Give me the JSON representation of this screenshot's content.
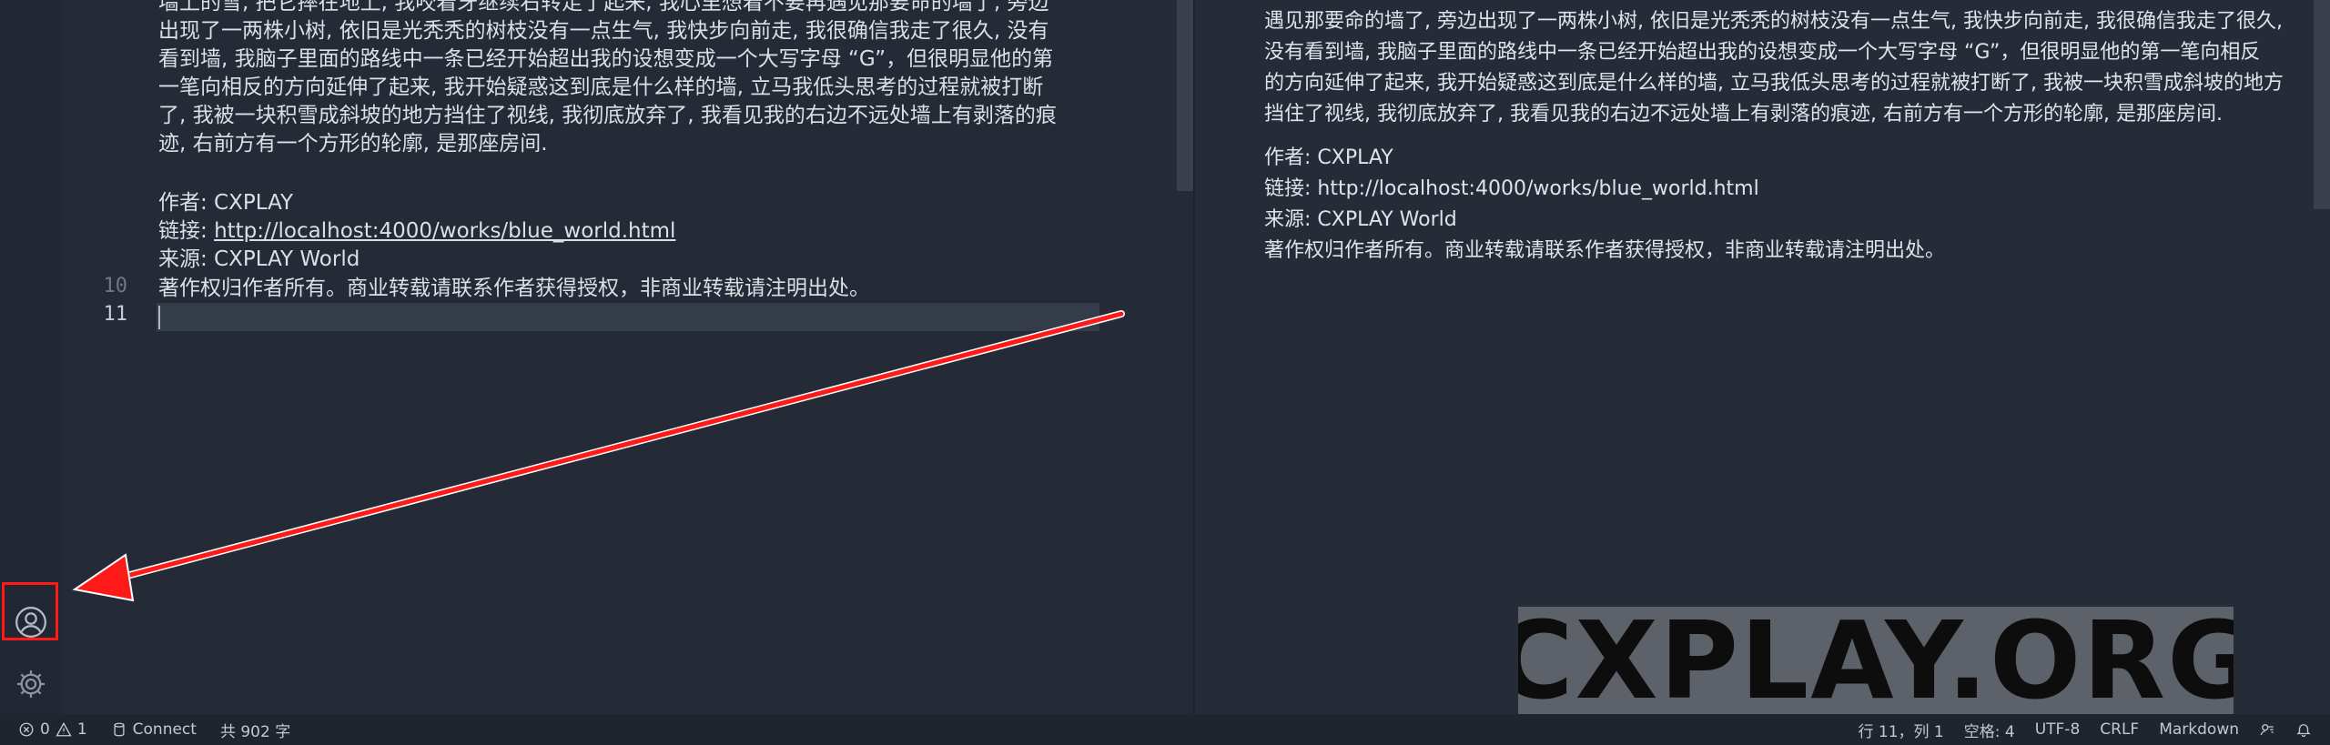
{
  "editor": {
    "lines": [
      "墙上的雪, 把它摔在地上, 我咬着牙继续右转走了起来, 我心里想着不要再遇见那要命的墙了, 旁边",
      "出现了一两株小树, 依旧是光秃秃的树枝没有一点生气, 我快步向前走, 我很确信我走了很久, 没有",
      "看到墙, 我脑子里面的路线中一条已经开始超出我的设想变成一个大写字母 “G”，但很明显他的第",
      "一笔向相反的方向延伸了起来, 我开始疑惑这到底是什么样的墙, 立马我低头思考的过程就被打断",
      "了, 我被一块积雪成斜坡的地方挡住了视线, 我彻底放弃了, 我看见我的右边不远处墙上有剥落的痕",
      "迹, 右前方有一个方形的轮廓, 是那座房间.",
      "",
      "作者: CXPLAY",
      "链接: ",
      "来源: CXPLAY World",
      "著作权归作者所有。商业转载请联系作者获得授权，非商业转载请注明出处。",
      ""
    ],
    "link_text": "http://localhost:4000/works/blue_world.html",
    "line_numbers": [
      "10",
      "11"
    ]
  },
  "preview": {
    "paragraph_lines": [
      "遇见那要命的墙了, 旁边出现了一两株小树, 依旧是光秃秃的树枝没有一点生气, 我快步向前走, 我很确信我走了很久,",
      "没有看到墙, 我脑子里面的路线中一条已经开始超出我的设想变成一个大写字母 “G”，但很明显他的第一笔向相反",
      "的方向延伸了起来, 我开始疑惑这到底是什么样的墙, 立马我低头思考的过程就被打断了, 我被一块积雪成斜坡的地方",
      "挡住了视线, 我彻底放弃了, 我看见我的右边不远处墙上有剥落的痕迹, 右前方有一个方形的轮廓, 是那座房间."
    ],
    "meta_lines": [
      "作者: CXPLAY",
      "链接: http://localhost:4000/works/blue_world.html",
      "来源: CXPLAY World",
      "著作权归作者所有。商业转载请联系作者获得授权，非商业转载请注明出处。"
    ]
  },
  "watermark": "CXPLAY.ORG",
  "status_bar": {
    "errors": "0",
    "warnings": "1",
    "connect": "Connect",
    "word_count": "共 902 字",
    "cursor_pos": "行 11，列 1",
    "spaces": "空格: 4",
    "encoding": "UTF-8",
    "eol": "CRLF",
    "language": "Markdown"
  },
  "icons": {
    "account": "account-icon",
    "settings": "gear-icon"
  },
  "colors": {
    "annotation": "#ff1a1a",
    "background": "#252b36"
  }
}
